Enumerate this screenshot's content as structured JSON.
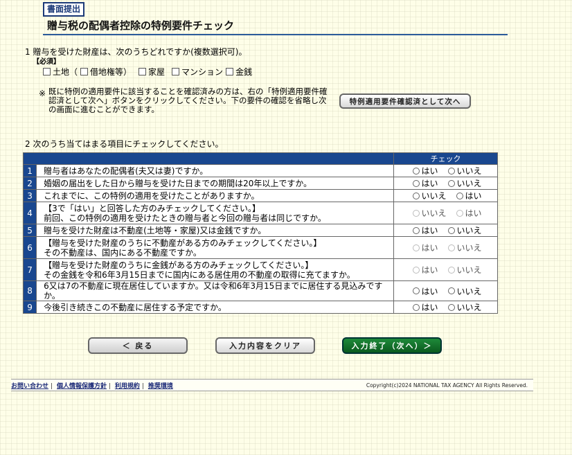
{
  "header": {
    "badge": "書面提出",
    "title": "贈与税の配偶者控除の特例要件チェック"
  },
  "q1": {
    "text": "1 贈与を受けた財産は、次のうちどれですか(複数選択可)。",
    "required": "【必須】",
    "options": [
      "土地（",
      "借地権等）",
      "家屋",
      "マンション",
      "金銭"
    ],
    "note_mark": "※",
    "note": "既に特例の適用要件に該当することを確認済みの方は、右の「特例適用要件確認済として次へ」ボタンをクリックしてください。下の要件の確認を省略し次の画面に進むことができます。",
    "skip_button": "特例適用要件確認済として次へ"
  },
  "q2": {
    "text": "2 次のうち当てはまる項目にチェックしてください。",
    "check_header": "チェック",
    "rows": [
      {
        "num": "1",
        "text": "贈与者はあなたの配偶者(夫又は妻)ですか。",
        "a": "はい",
        "b": "いいえ",
        "disabled": false
      },
      {
        "num": "2",
        "text": "婚姻の届出をした日から贈与を受けた日までの期間は20年以上ですか。",
        "a": "はい",
        "b": "いいえ",
        "disabled": false
      },
      {
        "num": "3",
        "text": "これまでに、この特例の適用を受けたことがありますか。",
        "a": "いいえ",
        "b": "はい",
        "disabled": false
      },
      {
        "num": "4",
        "text": "【3で「はい」と回答した方のみチェックしてください。】",
        "text2": "前回、この特例の適用を受けたときの贈与者と今回の贈与者は同じですか。",
        "a": "いいえ",
        "b": "はい",
        "disabled": true
      },
      {
        "num": "5",
        "text": "贈与を受けた財産は不動産(土地等・家屋)又は金銭ですか。",
        "a": "はい",
        "b": "いいえ",
        "disabled": false
      },
      {
        "num": "6",
        "text": "【贈与を受けた財産のうちに不動産がある方のみチェックしてください。】",
        "text2": "その不動産は、国内にある不動産ですか。",
        "a": "はい",
        "b": "いいえ",
        "disabled": true
      },
      {
        "num": "7",
        "text": "【贈与を受けた財産のうちに金銭がある方のみチェックしてください。】",
        "text2": "その金銭を令和6年3月15日までに国内にある居住用の不動産の取得に充てますか。",
        "a": "はい",
        "b": "いいえ",
        "disabled": true
      },
      {
        "num": "8",
        "text": "6又は7の不動産に現在居住していますか。又は令和6年3月15日までに居住する見込みですか。",
        "a": "はい",
        "b": "いいえ",
        "disabled": false
      },
      {
        "num": "9",
        "text": "今後引き続きこの不動産に居住する予定ですか。",
        "a": "はい",
        "b": "いいえ",
        "disabled": false
      }
    ]
  },
  "buttons": {
    "back": "＜ 戻る",
    "clear": "入力内容をクリア",
    "finish": "入力終了（次へ）＞"
  },
  "footer": {
    "links": [
      "お問い合わせ",
      "個人情報保護方針",
      "利用規約",
      "推奨環境"
    ],
    "copyright": "Copyright(c)2024 NATIONAL TAX AGENCY All Rights Reserved."
  }
}
